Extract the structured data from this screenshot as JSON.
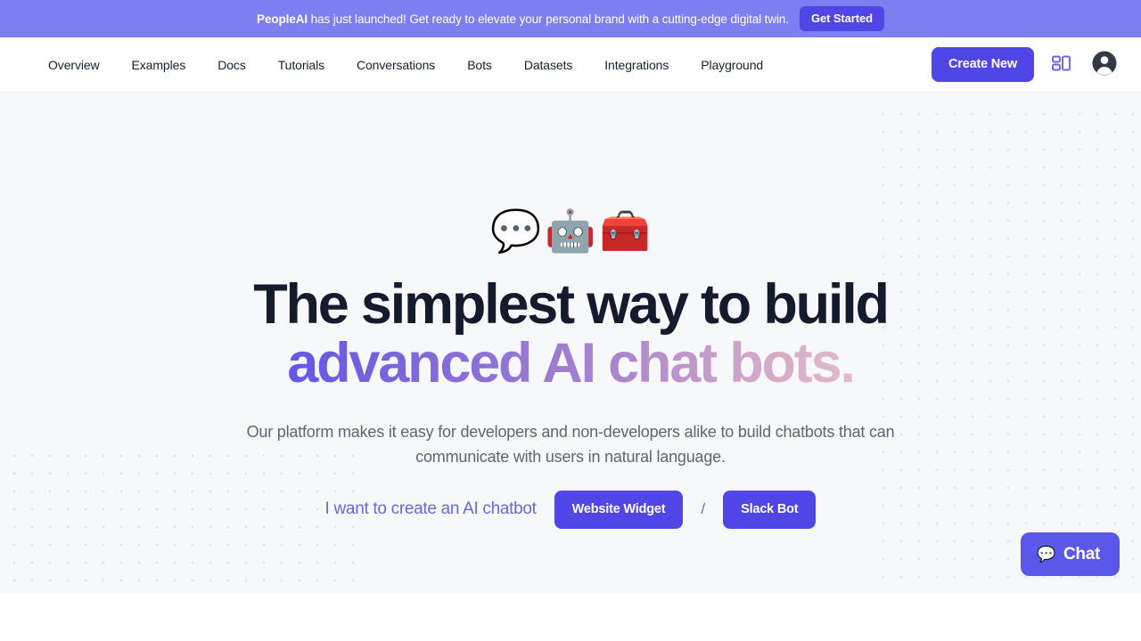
{
  "banner": {
    "brand": "PeopleAI",
    "message": " has just launched! Get ready to elevate your personal brand with a cutting-edge digital twin.",
    "cta_label": "Get Started",
    "background_color": "#7d7ef0",
    "cta_color": "#4f46e5"
  },
  "nav": {
    "links": [
      {
        "label": "Overview"
      },
      {
        "label": "Examples"
      },
      {
        "label": "Docs"
      },
      {
        "label": "Tutorials"
      },
      {
        "label": "Conversations"
      },
      {
        "label": "Bots"
      },
      {
        "label": "Datasets"
      },
      {
        "label": "Integrations"
      },
      {
        "label": "Playground"
      }
    ],
    "create_button": "Create New",
    "dashboard_icon": "dashboard-grid-icon",
    "account_icon": "account-avatar-icon",
    "accent_color": "#4f46e5"
  },
  "hero": {
    "emojis": [
      {
        "name": "speech-balloon-emoji",
        "glyph": "💬"
      },
      {
        "name": "robot-emoji",
        "glyph": "🤖"
      },
      {
        "name": "toolbox-emoji",
        "glyph": "🧰"
      }
    ],
    "headline_line1": "The simplest way to build",
    "headline_line2": "advanced AI chat bots.",
    "headline_color": "#141b2d",
    "gradient_start": "#5b52e8",
    "gradient_end": "#e3bdcf",
    "subtitle_line1": "Our platform makes it easy for developers and non-developers alike to build chatbots",
    "subtitle_line2": "that can communicate with users in natural language.",
    "cta_label": "I want to create an AI chatbot",
    "cta_primary": "Website Widget",
    "cta_separator": "/",
    "cta_secondary": "Slack Bot",
    "background_color": "#f7f8fa",
    "dot_color": "#e2e5ea"
  },
  "chat_widget": {
    "label": "Chat",
    "emoji": "💬",
    "background_color": "#5b57e8"
  }
}
